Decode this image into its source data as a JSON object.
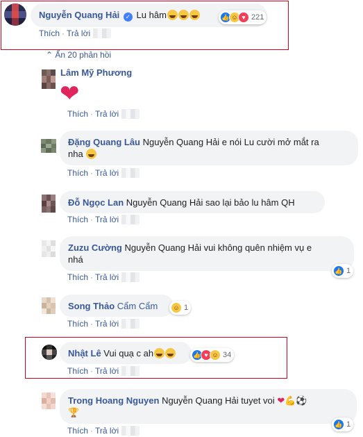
{
  "colors": {
    "link": "#385898",
    "bubble": "#f2f3f5",
    "highlight": "#d0021b"
  },
  "actions": {
    "like": "Thích",
    "reply": "Trả lời"
  },
  "top_comment": {
    "author": "Nguyễn Quang Hải",
    "text": "Lu hâm",
    "reaction_count": "221"
  },
  "expand_replies": "Ẩn 20 phản hồi",
  "replies": [
    {
      "author": "Lâm Mỹ Phương",
      "text": "",
      "sticker": "heart"
    },
    {
      "author": "Đặng Quang Lâu",
      "text": "Nguyễn Quang Hải e nói Lu cười mở mắt ra",
      "text2": "nha"
    },
    {
      "author": "Đỗ Ngọc Lan",
      "text": "Nguyễn Quang Hải sao lại bảo lu hâm QH"
    },
    {
      "author": "Zuzu Cường",
      "text": "Nguyễn Quang Hải vui không quên nhiệm vụ e",
      "text2": "nhá",
      "reaction_count": "1"
    },
    {
      "author": "Song Thảo",
      "text": "Cẩm Cẩm",
      "reaction_count": "1"
    },
    {
      "author": "Nhật Lê",
      "text": "Vui quạ c ah",
      "reaction_count": "34"
    },
    {
      "author": "Trong Hoang Nguyen",
      "text": "Nguyễn Quang Hải tuyet voi",
      "reaction_count": "1"
    }
  ]
}
